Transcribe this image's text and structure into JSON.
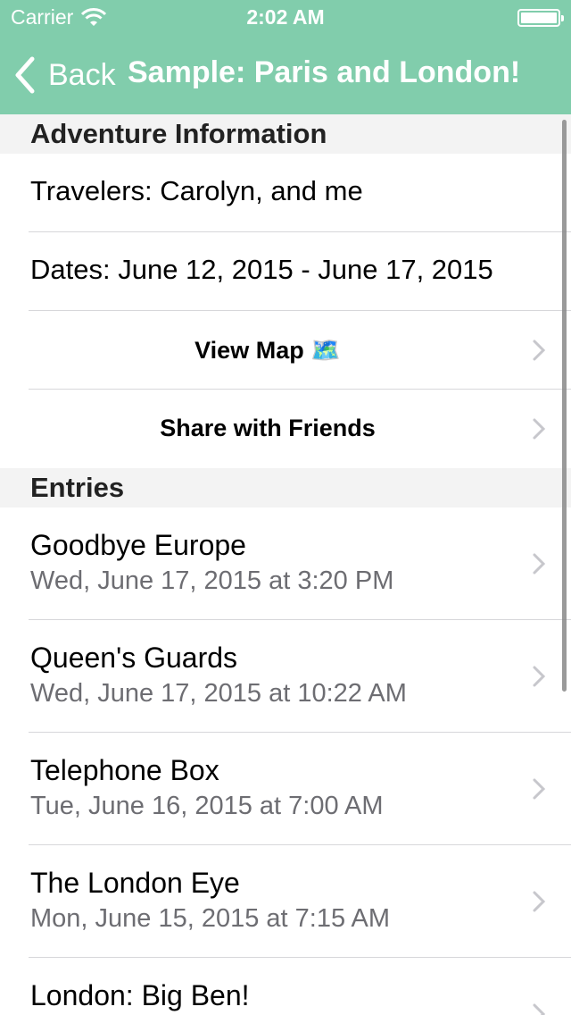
{
  "status": {
    "carrier": "Carrier",
    "time": "2:02 AM"
  },
  "nav": {
    "back_label": "Back",
    "title": "Sample: Paris and London!"
  },
  "sections": {
    "info": {
      "header": "Adventure Information",
      "travelers": "Travelers: Carolyn, and me",
      "dates": "Dates: June 12, 2015 - June 17, 2015",
      "view_map": "View Map 🗺️",
      "share": "Share with Friends"
    },
    "entries": {
      "header": "Entries",
      "items": [
        {
          "title": "Goodbye Europe",
          "date": "Wed, June 17, 2015 at 3:20 PM"
        },
        {
          "title": "Queen's Guards",
          "date": "Wed, June 17, 2015 at 10:22 AM"
        },
        {
          "title": "Telephone Box",
          "date": "Tue, June 16, 2015 at 7:00 AM"
        },
        {
          "title": "The London Eye",
          "date": "Mon, June 15, 2015 at 7:15 AM"
        },
        {
          "title": "London: Big Ben!",
          "date": ""
        }
      ]
    }
  },
  "colors": {
    "nav_bg": "#81CDAC",
    "header_bg": "#F3F3F3",
    "subtitle": "#6D6D72",
    "chevron": "#C7C7CC"
  }
}
